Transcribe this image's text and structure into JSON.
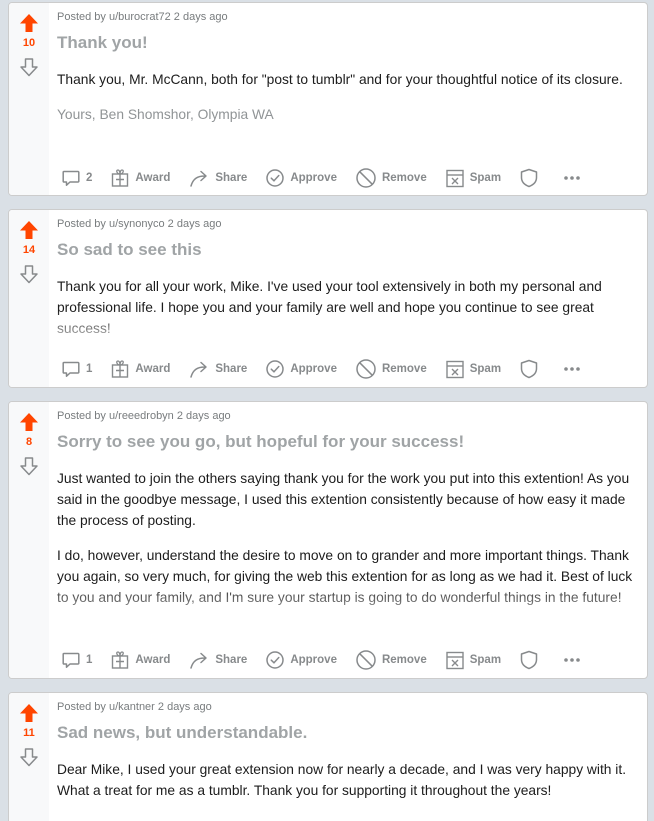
{
  "posts": [
    {
      "score": "10",
      "meta": "Posted by u/burocrat72 2 days ago",
      "title": "Thank you!",
      "paragraphs": [
        "Thank you, Mr. McCann, both for \"post to tumblr\" and for your thoughtful notice of its closure.",
        "Yours, Ben Shomshor, Olympia WA"
      ],
      "comments": "2"
    },
    {
      "score": "14",
      "meta": "Posted by u/synonyco 2 days ago",
      "title": "So sad to see this",
      "paragraphs": [
        "Thank you for all your work, Mike. I've used your tool extensively in both my personal and professional life. I hope you and your family are well and hope you continue to see great success!"
      ],
      "comments": "1"
    },
    {
      "score": "8",
      "meta": "Posted by u/reeedrobyn 2 days ago",
      "title": "Sorry to see you go, but hopeful for your success!",
      "paragraphs": [
        "Just wanted to join the others saying thank you for the work you put into this extention! As you said in the goodbye message, I used this extention consistently because of how easy it made the process of posting.",
        "I do, however, understand the desire to move on to grander and more important things. Thank you again, so very much, for giving the web this extention for as long as we had it. Best of luck to you and your family, and I'm sure your startup is going to do wonderful things in the future!"
      ],
      "comments": "1"
    },
    {
      "score": "11",
      "meta": "Posted by u/kantner 2 days ago",
      "title": "Sad news, but understandable.",
      "paragraphs": [
        "Dear Mike, I used your great extension now for nearly a decade, and I was very happy with it. What a treat for me as a tumblr. Thank you for supporting it throughout the years!"
      ],
      "comments": ""
    }
  ],
  "actions": {
    "award": "Award",
    "share": "Share",
    "approve": "Approve",
    "remove": "Remove",
    "spam": "Spam"
  },
  "colors": {
    "upvote": "#ff4500",
    "background": "#dae0e6",
    "action_text": "#878a8c"
  }
}
